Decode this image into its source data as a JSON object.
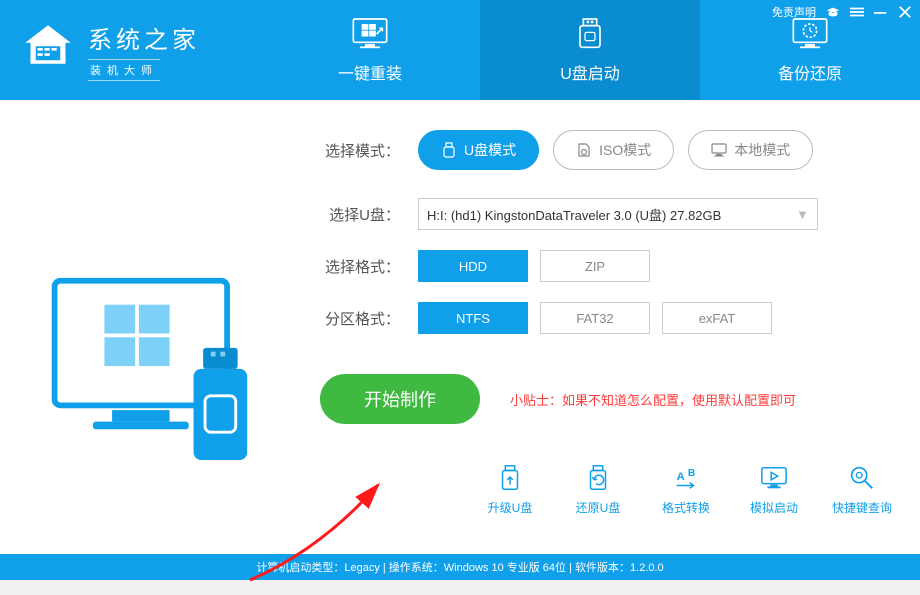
{
  "header": {
    "logo_title": "系统之家",
    "logo_sub": "装机大师",
    "disclaimer": "免责声明"
  },
  "nav": [
    {
      "label": "一键重装"
    },
    {
      "label": "U盘启动"
    },
    {
      "label": "备份还原"
    }
  ],
  "labels": {
    "mode": "选择模式：",
    "udisk": "选择U盘：",
    "format": "选择格式：",
    "partition": "分区格式："
  },
  "modes": [
    {
      "label": "U盘模式"
    },
    {
      "label": "ISO模式"
    },
    {
      "label": "本地模式"
    }
  ],
  "udisk_value": "H:I: (hd1) KingstonDataTraveler 3.0 (U盘) 27.82GB",
  "format_options": [
    "HDD",
    "ZIP"
  ],
  "partition_options": [
    "NTFS",
    "FAT32",
    "exFAT"
  ],
  "start_label": "开始制作",
  "tip": "小贴士：如果不知道怎么配置，使用默认配置即可",
  "actions": [
    {
      "label": "升级U盘"
    },
    {
      "label": "还原U盘"
    },
    {
      "label": "格式转换"
    },
    {
      "label": "模拟启动"
    },
    {
      "label": "快捷键查询"
    }
  ],
  "footer": "计算机启动类型：Legacy | 操作系统：Windows 10 专业版 64位 | 软件版本：1.2.0.0"
}
